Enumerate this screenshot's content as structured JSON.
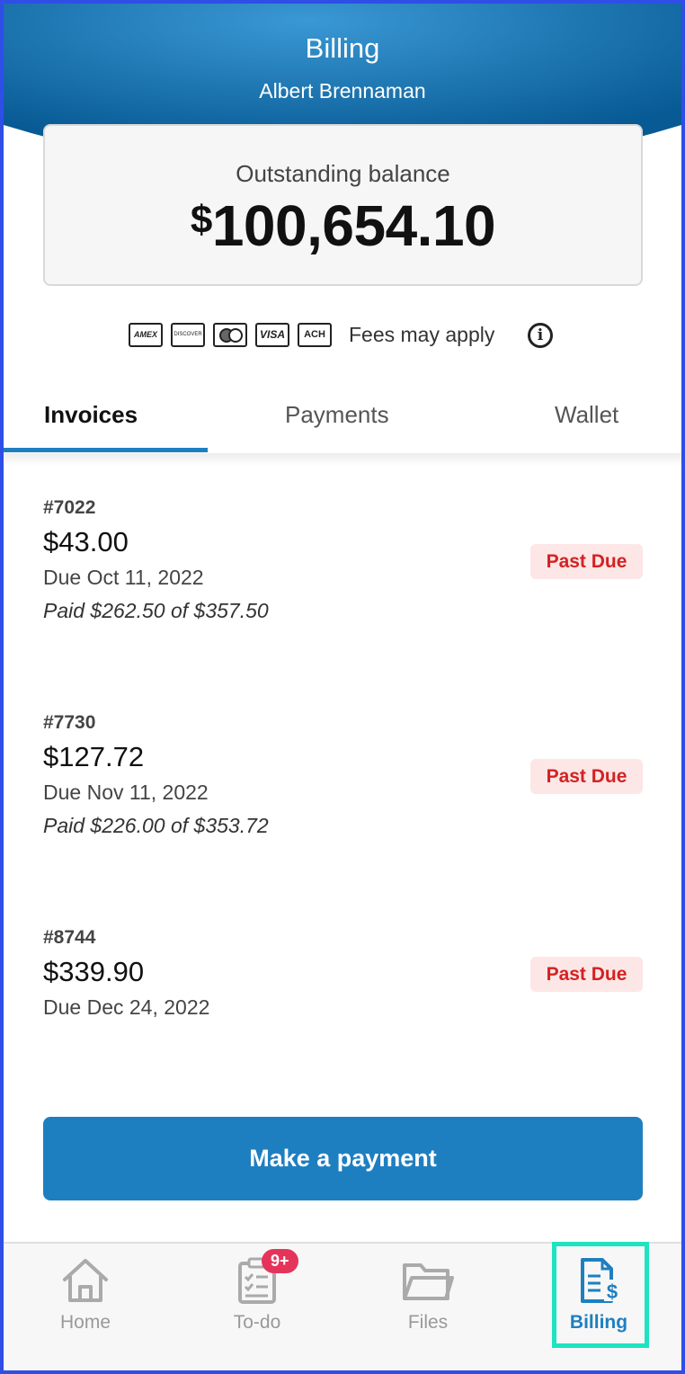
{
  "header": {
    "title": "Billing",
    "subtitle": "Albert Brennaman"
  },
  "balance": {
    "label": "Outstanding balance",
    "currency": "$",
    "amount": "100,654.10"
  },
  "payment_methods": {
    "cards": [
      "AMEX",
      "DISCOVER",
      "mastercard",
      "VISA",
      "ACH"
    ],
    "fees_text": "Fees may apply",
    "info_icon": "info-icon"
  },
  "tabs": [
    {
      "label": "Invoices",
      "active": true
    },
    {
      "label": "Payments",
      "active": false
    },
    {
      "label": "Wallet",
      "active": false
    }
  ],
  "invoices": [
    {
      "number": "#7022",
      "amount": "$43.00",
      "due": "Due Oct 11, 2022",
      "paid": "Paid $262.50 of $357.50",
      "status": "Past Due"
    },
    {
      "number": "#7730",
      "amount": "$127.72",
      "due": "Due Nov 11, 2022",
      "paid": "Paid $226.00 of $353.72",
      "status": "Past Due"
    },
    {
      "number": "#8744",
      "amount": "$339.90",
      "due": "Due Dec 24, 2022",
      "paid": "",
      "status": "Past Due"
    }
  ],
  "actions": {
    "make_payment": "Make a payment"
  },
  "bottom_nav": {
    "items": [
      {
        "label": "Home",
        "icon": "home-icon",
        "active": false
      },
      {
        "label": "To-do",
        "icon": "clipboard-icon",
        "active": false,
        "badge": "9+"
      },
      {
        "label": "Files",
        "icon": "folder-icon",
        "active": false
      },
      {
        "label": "Billing",
        "icon": "billing-icon",
        "active": true
      }
    ]
  },
  "colors": {
    "header_gradient_start": "#3a98d4",
    "header_gradient_end": "#075a94",
    "accent": "#1e7fc0",
    "past_due_text": "#d32222",
    "past_due_bg": "#fde6e6",
    "badge": "#e5345a",
    "highlight": "#1ee3c0"
  }
}
